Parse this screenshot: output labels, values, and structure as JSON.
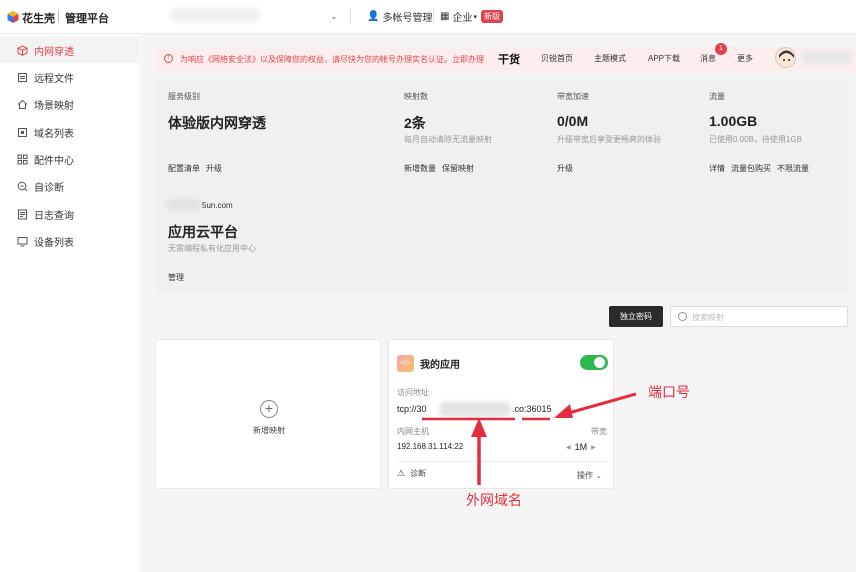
{
  "brand": {
    "name": "花生壳",
    "platform": "管理平台"
  },
  "topbar": {
    "multi_account": "多帐号管理",
    "enterprise": "企业",
    "new_badge": "新版"
  },
  "sidebar": {
    "items": [
      {
        "label": "内网穿透",
        "icon": "cube-icon",
        "active": true
      },
      {
        "label": "远程文件",
        "icon": "file-icon"
      },
      {
        "label": "场景映射",
        "icon": "home-icon"
      },
      {
        "label": "域名列表",
        "icon": "domain-icon"
      },
      {
        "label": "配件中心",
        "icon": "grid-icon"
      },
      {
        "label": "自诊断",
        "icon": "diagnose-icon"
      },
      {
        "label": "日志查询",
        "icon": "log-icon"
      },
      {
        "label": "设备列表",
        "icon": "monitor-icon"
      }
    ]
  },
  "banner": {
    "text": "为响应《网络安全法》以及保障您的权益，请尽快为您的帐号办理实名认证。立即办理",
    "nav": [
      "干货",
      "贝锐首页",
      "主题模式",
      "APP下载",
      "消息",
      "更多"
    ],
    "msg_count": "1"
  },
  "overview": {
    "service": {
      "title": "服务级别",
      "value": "体验版内网穿透",
      "links": [
        "配置清单",
        "升级"
      ]
    },
    "mappings": {
      "title": "映射数",
      "value": "2条",
      "desc": "每月自动清除无流量映射",
      "links": [
        "新增数量",
        "保留映射"
      ]
    },
    "bandwidth": {
      "title": "带宽加速",
      "value": "0/0M",
      "desc": "升级带宽后享受更畅爽的体验",
      "links": [
        "升级"
      ]
    },
    "traffic": {
      "title": "流量",
      "value": "1.00GB",
      "desc": "已使用0.00B，待使用1GB",
      "links": [
        "详情",
        "流量包购买",
        "不限流量"
      ]
    },
    "cloud": {
      "domain": "5un.com",
      "title": "应用云平台",
      "desc": "无需编程私有化应用中心",
      "link": "管理"
    }
  },
  "toolbar": {
    "button": "独立密码",
    "search_placeholder": "搜索映射"
  },
  "add_card": {
    "label": "新增映射"
  },
  "app_card": {
    "name": "我的应用",
    "enabled": true,
    "access_label": "访问地址",
    "access_prefix": "tcp://30",
    "access_suffix": ".co:36015",
    "host_label": "内网主机",
    "host_value": "192.168.31.114:22",
    "bw_label": "带宽",
    "bw_value": "1M",
    "diagnose": "诊断",
    "operate": "操作"
  },
  "annotations": {
    "port": "端口号",
    "domain": "外网域名"
  },
  "colors": {
    "accent": "#e0434e",
    "toggle": "#2db84d",
    "dark_button": "#2b2b2b"
  }
}
